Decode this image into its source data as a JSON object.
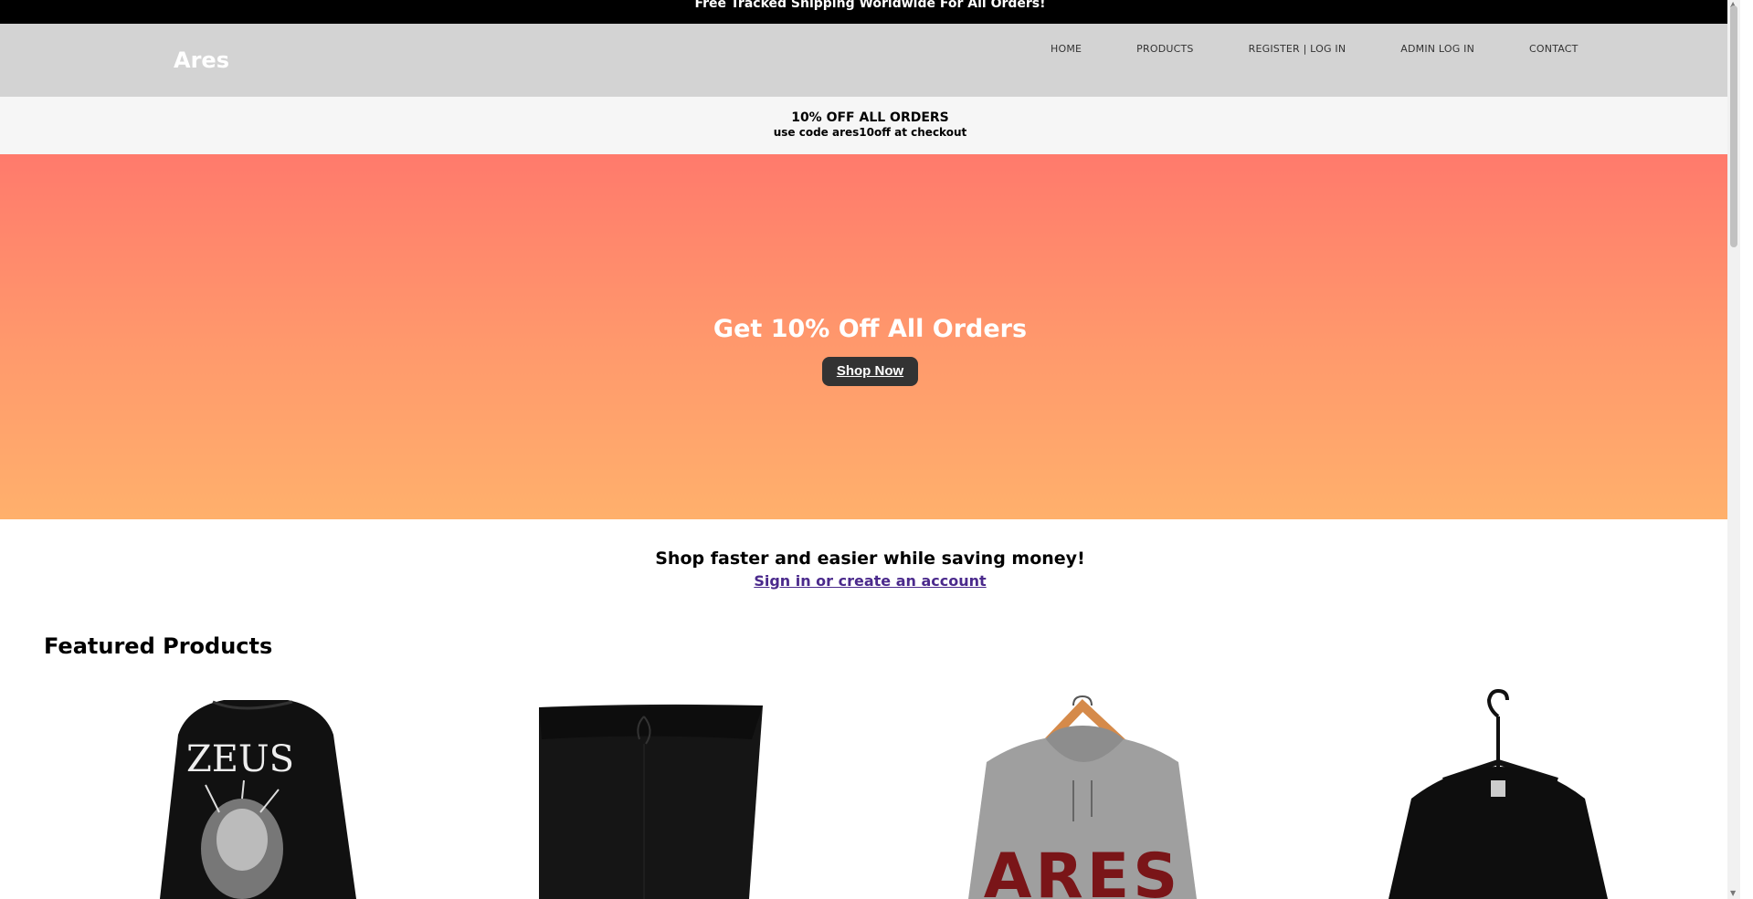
{
  "topbar": {
    "text": "Free Tracked Shipping Worldwide For All Orders!"
  },
  "header": {
    "brand": "Ares",
    "nav": [
      "HOME",
      "PRODUCTS",
      "REGISTER | LOG IN",
      "ADMIN LOG IN",
      "CONTACT"
    ]
  },
  "promo": {
    "line1": "10% OFF ALL ORDERS",
    "line2": "use code ares10off at checkout"
  },
  "hero": {
    "title": "Get 10% Off All Orders",
    "button": "Shop Now"
  },
  "signup": {
    "text": "Shop faster and easier while saving money!",
    "link": "Sign in or create an account"
  },
  "featured": {
    "title": "Featured Products",
    "products": [
      {
        "icon": "zeus-jacket-image",
        "print": "ZEUS"
      },
      {
        "icon": "black-shorts-image"
      },
      {
        "icon": "grey-hoodie-image",
        "print": "ARES"
      },
      {
        "icon": "black-sweatshirt-image"
      }
    ]
  },
  "colors": {
    "topbar": "#000000",
    "header": "#d3d3d3",
    "hero_top": "#ff7a6c",
    "hero_bottom": "#ffb06c",
    "button": "#333333",
    "link": "#4b2a8c"
  }
}
